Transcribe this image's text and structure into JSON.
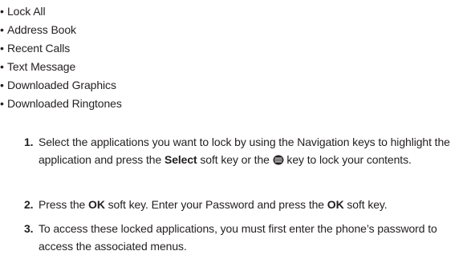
{
  "bullets": {
    "dot": "•",
    "items": [
      "Lock All",
      "Address Book",
      "Recent Calls",
      "Text Message",
      "Downloaded Graphics",
      "Downloaded Ringtones"
    ]
  },
  "steps": [
    {
      "number": "1.",
      "part1": "Select the applications you want to lock by using the Navigation keys to highlight the application and press the ",
      "bold1": "Select",
      "part2": " soft key or the ",
      "icon": "ok-key-icon",
      "part3": " key to lock your contents."
    },
    {
      "number": "2.",
      "part1": "Press the ",
      "bold1": "OK",
      "part2": " soft key. Enter your Password and press the ",
      "bold2": "OK",
      "part3": " soft key."
    },
    {
      "number": "3.",
      "part1": "To access these locked applications, you must first enter the phone’s password to access the associated menus."
    }
  ]
}
